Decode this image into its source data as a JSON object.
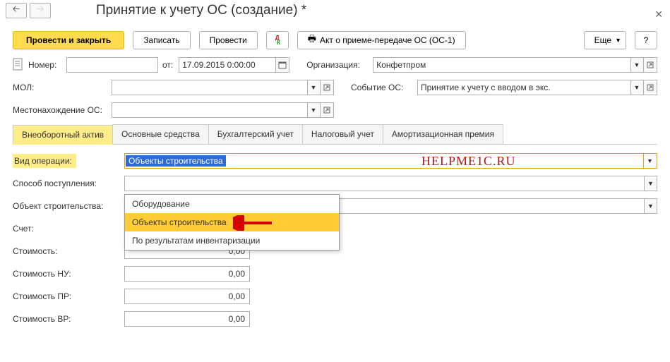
{
  "title": "Принятие к учету ОС (создание) *",
  "toolbar": {
    "post_close": "Провести и закрыть",
    "write": "Записать",
    "post": "Провести",
    "print_act": "Акт о приеме-передаче ОС (ОС-1)",
    "more": "Еще",
    "help": "?"
  },
  "header": {
    "number_label": "Номер:",
    "number": "",
    "ot": "от:",
    "date": "17.09.2015 0:00:00",
    "org_label": "Организация:",
    "org": "Конфетпром",
    "mol_label": "МОЛ:",
    "mol": "",
    "event_label": "Событие ОС:",
    "event": "Принятие к учету с вводом в экс.",
    "loc_label": "Местонахождение ОС:",
    "loc": ""
  },
  "tabs": [
    "Внеоборотный актив",
    "Основные средства",
    "Бухгалтерский учет",
    "Налоговый учет",
    "Амортизационная премия"
  ],
  "body": {
    "op_type_label": "Вид операции:",
    "op_type_value": "Объекты строительства",
    "receipt_label": "Способ поступления:",
    "obj_label": "Объект строительства:",
    "account_label": "Счет:",
    "cost_label": "Стоимость:",
    "cost": "0,00",
    "cost_nu_label": "Стоимость НУ:",
    "cost_nu": "0,00",
    "cost_pr_label": "Стоимость ПР:",
    "cost_pr": "0,00",
    "cost_vr_label": "Стоимость ВР:",
    "cost_vr": "0,00"
  },
  "dropdown": {
    "items": [
      "Оборудование",
      "Объекты строительства",
      "По результатам инвентаризации"
    ]
  },
  "watermark": "HELPME1C.RU"
}
